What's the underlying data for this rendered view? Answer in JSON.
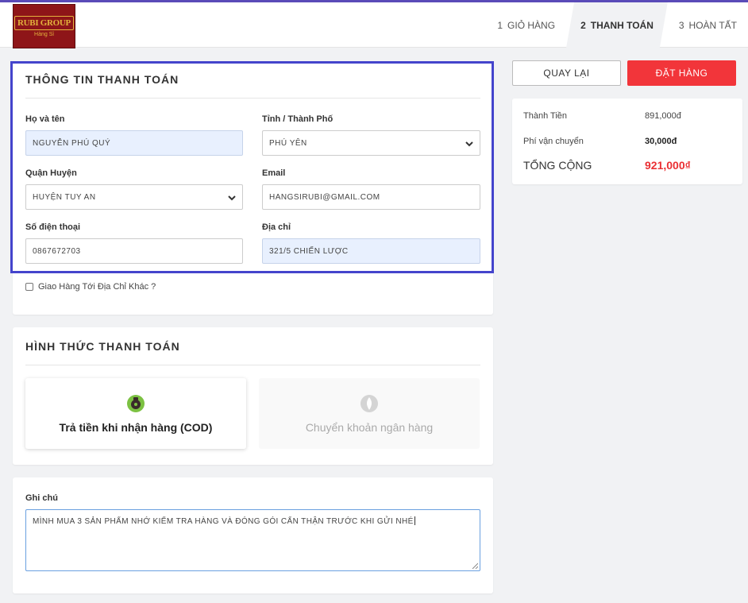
{
  "header": {
    "logo_text": "RUBI GROUP",
    "logo_sub": "Hàng Sỉ",
    "steps": [
      {
        "num": "1",
        "label": "GIỎ HÀNG"
      },
      {
        "num": "2",
        "label": "THANH TOÁN"
      },
      {
        "num": "3",
        "label": "HOÀN TẤT"
      }
    ]
  },
  "billing": {
    "title": "THÔNG TIN THANH TOÁN",
    "name_label": "Họ và tên",
    "name_value": "NGUYỄN PHÚ QUÝ",
    "province_label": "Tỉnh / Thành Phố",
    "province_value": "PHÚ YÊN",
    "district_label": "Quận Huyện",
    "district_value": "HUYỆN TUY AN",
    "email_label": "Email",
    "email_value": "HANGSIRUBI@GMAIL.COM",
    "phone_label": "Số điện thoại",
    "phone_value": "0867672703",
    "address_label": "Địa chỉ",
    "address_value": "321/5 CHIẾN LƯỢC",
    "other_address_label": "Giao Hàng Tới Địa Chỉ Khác ?"
  },
  "payment": {
    "title": "HÌNH THỨC THANH TOÁN",
    "cod_label": "Trả tiền khi nhận hàng (COD)",
    "bank_label": "Chuyển khoản ngân hàng"
  },
  "note": {
    "label": "Ghi chú",
    "value": "MÌNH MUA 3 SẢN PHẨM NHỚ KIỂM TRA HÀNG VÀ ĐÓNG GÓI CẨN THẬN TRƯỚC KHI GỬI NHÉ"
  },
  "actions": {
    "back_label": "QUAY LẠI",
    "order_label": "ĐẶT HÀNG"
  },
  "summary": {
    "subtotal_label": "Thành Tiền",
    "subtotal_value": "891,000đ",
    "shipping_label": "Phí vận chuyển",
    "shipping_value": "30,000đ",
    "total_label": "TỔNG CỘNG",
    "total_value": "921,000₫"
  },
  "colors": {
    "accent": "#4444cc",
    "order_button": "#f2353a",
    "total": "#ea2f33"
  }
}
